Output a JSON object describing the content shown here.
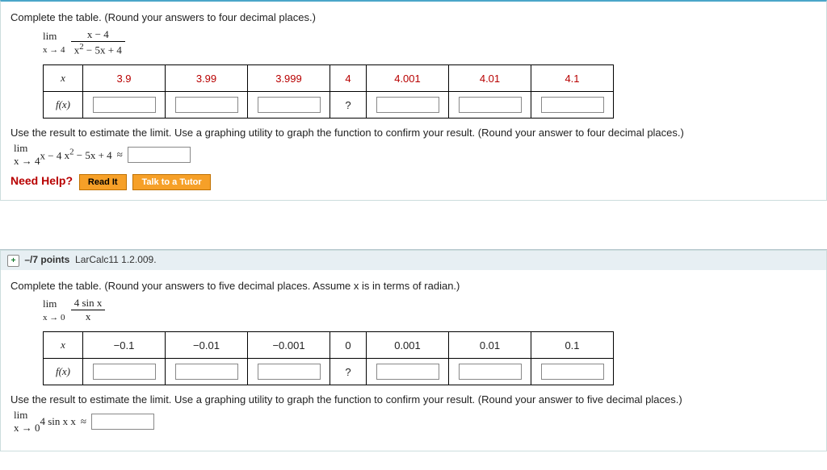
{
  "q1": {
    "instruction": "Complete the table. (Round your answers to four decimal places.)",
    "formula_num": "x − 4",
    "formula_den_left": "x",
    "formula_den_sup": "2",
    "formula_den_right": " − 5x + 4",
    "limtxt": "lim",
    "limsub": "x → 4",
    "row_label_x": "x",
    "row_label_fx": "f(x)",
    "xvals": [
      "3.9",
      "3.99",
      "3.999",
      "4",
      "4.001",
      "4.01",
      "4.1"
    ],
    "center_fx": "?",
    "estimate": "Use the result to estimate the limit. Use a graphing utility to graph the function to confirm your result. (Round your answer to four decimal places.)",
    "approx": "≈",
    "needhelp": "Need Help?",
    "btn_read": "Read It",
    "btn_talk": "Talk to a Tutor"
  },
  "q2header": {
    "pts": "–/7 points",
    "ref": "LarCalc11 1.2.009."
  },
  "q2": {
    "instruction": "Complete the table. (Round your answers to five decimal places. Assume x is in terms of radian.)",
    "formula_num": "4 sin x",
    "formula_den": "x",
    "limtxt": "lim",
    "limsub": "x → 0",
    "row_label_x": "x",
    "row_label_fx": "f(x)",
    "xvals": [
      "−0.1",
      "−0.01",
      "−0.001",
      "0",
      "0.001",
      "0.01",
      "0.1"
    ],
    "center_fx": "?",
    "estimate": "Use the result to estimate the limit. Use a graphing utility to graph the function to confirm your result. (Round your answer to five decimal places.)",
    "approx": "≈"
  }
}
